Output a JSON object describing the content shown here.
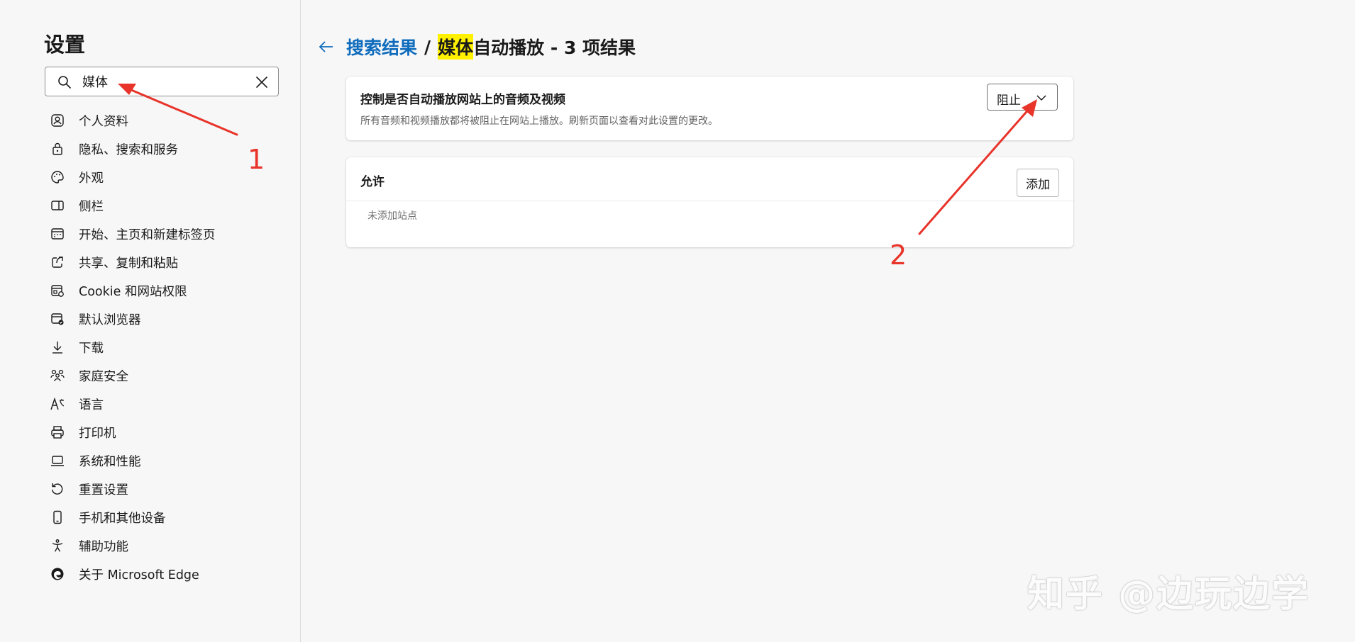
{
  "sidebar": {
    "title": "设置",
    "search": {
      "value": "媒体",
      "placeholder": ""
    },
    "items": [
      {
        "label": "个人资料",
        "icon": "profile-icon"
      },
      {
        "label": "隐私、搜索和服务",
        "icon": "lock-icon"
      },
      {
        "label": "外观",
        "icon": "palette-icon"
      },
      {
        "label": "侧栏",
        "icon": "sidebar-icon"
      },
      {
        "label": "开始、主页和新建标签页",
        "icon": "home-grid-icon"
      },
      {
        "label": "共享、复制和粘贴",
        "icon": "share-icon"
      },
      {
        "label": "Cookie 和网站权限",
        "icon": "cookie-site-icon"
      },
      {
        "label": "默认浏览器",
        "icon": "browser-default-icon"
      },
      {
        "label": "下载",
        "icon": "download-icon"
      },
      {
        "label": "家庭安全",
        "icon": "family-icon"
      },
      {
        "label": "语言",
        "icon": "language-icon"
      },
      {
        "label": "打印机",
        "icon": "printer-icon"
      },
      {
        "label": "系统和性能",
        "icon": "laptop-icon"
      },
      {
        "label": "重置设置",
        "icon": "reset-icon"
      },
      {
        "label": "手机和其他设备",
        "icon": "phone-icon"
      },
      {
        "label": "辅助功能",
        "icon": "accessibility-icon"
      },
      {
        "label": "关于 Microsoft Edge",
        "icon": "edge-logo-icon"
      }
    ]
  },
  "header": {
    "breadcrumb_link": "搜索结果",
    "separator": "/",
    "highlight": "媒体",
    "rest": "自动播放 - 3 项结果"
  },
  "autoplay_card": {
    "title": "控制是否自动播放网站上的音频及视频",
    "description": "所有音频和视频播放都将被阻止在网站上播放。刷新页面以查看对此设置的更改。",
    "dropdown_value": "阻止"
  },
  "allow_card": {
    "title": "允许",
    "add_label": "添加",
    "empty_text": "未添加站点"
  },
  "annotations": {
    "one": "1",
    "two": "2"
  },
  "watermark": "知乎 @边玩边学",
  "colors": {
    "accent": "#0f6cbd",
    "highlight": "#fff100",
    "annotation": "#e8342a"
  }
}
